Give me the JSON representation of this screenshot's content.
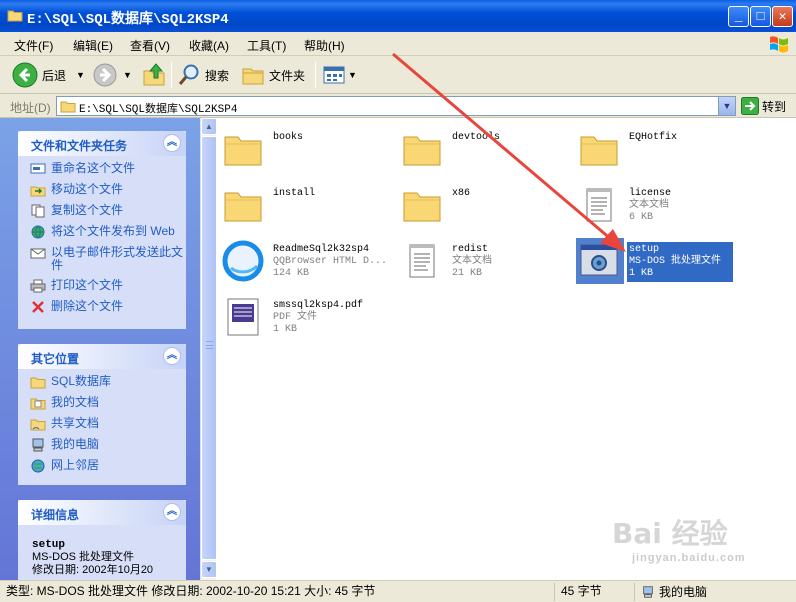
{
  "window": {
    "title": "E:\\SQL\\SQL数据库\\SQL2KSP4",
    "controls": [
      "minimize",
      "maximize",
      "close"
    ]
  },
  "menu": [
    "文件(F)",
    "编辑(E)",
    "查看(V)",
    "收藏(A)",
    "工具(T)",
    "帮助(H)"
  ],
  "toolbar": {
    "back_label": "后退",
    "search_label": "搜索",
    "folders_label": "文件夹"
  },
  "address": {
    "label": "地址(D)",
    "value": "E:\\SQL\\SQL数据库\\SQL2KSP4",
    "go_label": "转到"
  },
  "left_panel": {
    "tasks": {
      "title": "文件和文件夹任务",
      "items": [
        {
          "label": "重命名这个文件",
          "icon": "rename-icon"
        },
        {
          "label": "移动这个文件",
          "icon": "move-icon"
        },
        {
          "label": "复制这个文件",
          "icon": "copy-icon"
        },
        {
          "label": "将这个文件发布到 Web",
          "icon": "globe-icon"
        },
        {
          "label": "以电子邮件形式发送此文件",
          "icon": "email-icon"
        },
        {
          "label": "打印这个文件",
          "icon": "printer-icon"
        },
        {
          "label": "删除这个文件",
          "icon": "delete-icon"
        }
      ]
    },
    "other_places": {
      "title": "其它位置",
      "items": [
        {
          "label": "SQL数据库",
          "icon": "folder-icon"
        },
        {
          "label": "我的文档",
          "icon": "my-documents-icon"
        },
        {
          "label": "共享文档",
          "icon": "shared-documents-icon"
        },
        {
          "label": "我的电脑",
          "icon": "my-computer-icon"
        },
        {
          "label": "网上邻居",
          "icon": "network-icon"
        }
      ]
    },
    "details": {
      "title": "详细信息",
      "name": "setup",
      "type": "MS-DOS 批处理文件",
      "modified": "修改日期: 2002年10月20"
    }
  },
  "files": [
    {
      "name": "books",
      "kind": "folder"
    },
    {
      "name": "devtools",
      "kind": "folder"
    },
    {
      "name": "EQHotfix",
      "kind": "folder"
    },
    {
      "name": "install",
      "kind": "folder"
    },
    {
      "name": "x86",
      "kind": "folder"
    },
    {
      "name": "license",
      "kind": "text",
      "type": "文本文档",
      "size": "6 KB"
    },
    {
      "name": "ReadmeSql2k32sp4",
      "kind": "html",
      "type": "QQBrowser HTML D...",
      "size": "124 KB"
    },
    {
      "name": "redist",
      "kind": "text",
      "type": "文本文档",
      "size": "21 KB"
    },
    {
      "name": "setup",
      "kind": "batch",
      "type": "MS-DOS 批处理文件",
      "size": "1 KB",
      "selected": true
    },
    {
      "name": "smssql2ksp4.pdf",
      "kind": "pdf",
      "type": "PDF 文件",
      "size": "1 KB"
    }
  ],
  "status": {
    "info": "类型: MS-DOS 批处理文件 修改日期: 2002-10-20 15:21 大小: 45 字节",
    "size": "45 字节",
    "location": "我的电脑"
  },
  "watermark": {
    "main": "Bai 经验",
    "sub": "jingyan.baidu.com"
  },
  "colors": {
    "titlebar": "#0050d8",
    "selection": "#316ac5",
    "task_link": "#215dc6",
    "annotation_arrow": "#e8463c"
  }
}
